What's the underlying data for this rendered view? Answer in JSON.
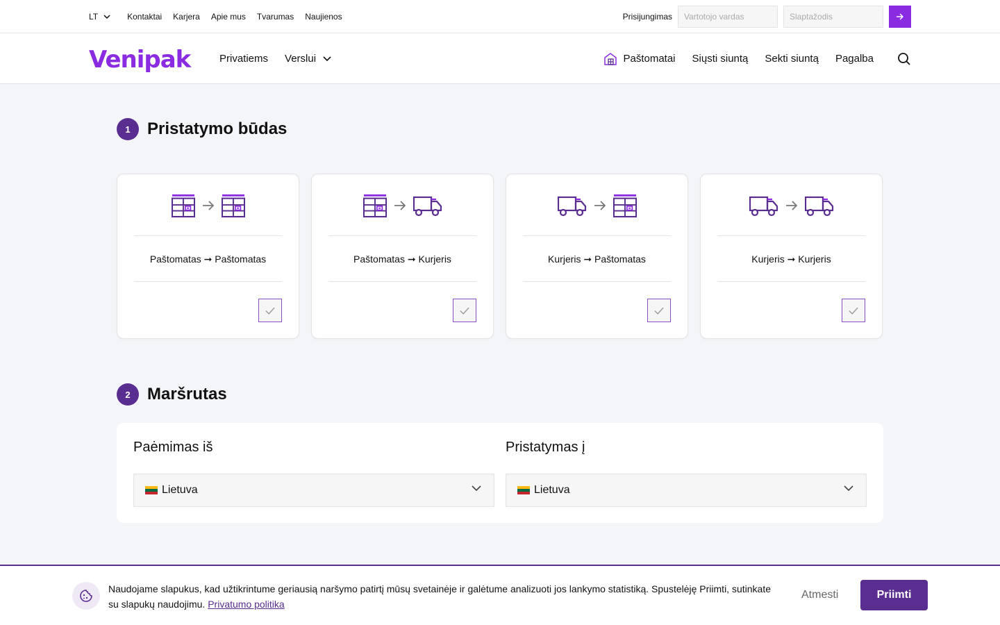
{
  "topbar": {
    "lang": "LT",
    "links": [
      "Kontaktai",
      "Karjera",
      "Apie mus",
      "Tvarumas",
      "Naujienos"
    ],
    "login_label": "Prisijungimas",
    "username_placeholder": "Vartotojo vardas",
    "password_placeholder": "Slaptažodis"
  },
  "nav": {
    "logo": "Venipak",
    "left": [
      "Privatiems",
      "Verslui"
    ],
    "right": [
      "Paštomatai",
      "Siųsti siuntą",
      "Sekti siuntą",
      "Pagalba"
    ]
  },
  "delivery": {
    "step": "1",
    "title": "Pristatymo būdas",
    "options": [
      {
        "label": "Paštomatas ➞ Paštomatas",
        "from_icon": "parcel-locker-icon",
        "to_icon": "parcel-locker-icon"
      },
      {
        "label": "Paštomatas ➞ Kurjeris",
        "from_icon": "parcel-locker-icon",
        "to_icon": "truck-icon"
      },
      {
        "label": "Kurjeris ➞ Paštomatas",
        "from_icon": "truck-icon",
        "to_icon": "parcel-locker-icon"
      },
      {
        "label": "Kurjeris ➞ Kurjeris",
        "from_icon": "truck-icon",
        "to_icon": "truck-icon"
      }
    ]
  },
  "route": {
    "step": "2",
    "title": "Maršrutas",
    "from_label": "Paėmimas iš",
    "from_value": "Lietuva",
    "to_label": "Pristatymas į",
    "to_value": "Lietuva"
  },
  "cookie": {
    "text": "Naudojame slapukus, kad užtikrintume geriausią naršymo patirtį mūsų svetainėje ir galėtume analizuoti jos lankymo statistiką. Spustelėję Priimti, sutinkate su slapukų naudojimu.",
    "policy_link": "Privatumo politika",
    "reject": "Atmesti",
    "accept": "Priimti"
  },
  "colors": {
    "brand": "#8a2be2",
    "brand_dark": "#5a2d91",
    "background": "#f4f5f8"
  }
}
